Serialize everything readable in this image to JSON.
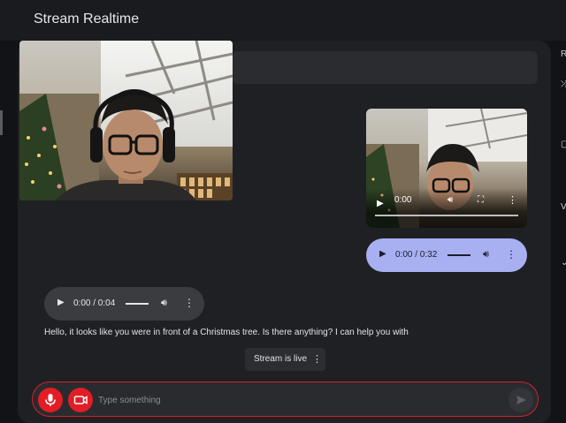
{
  "app": {
    "title": "Stream Realtime"
  },
  "right_rail": {
    "items": [
      "R",
      "⤮",
      "▢",
      "V",
      "⌄"
    ]
  },
  "video_message": {
    "time": "0:00",
    "play_icon": "play-icon",
    "volume_icon": "volume-icon",
    "fullscreen_icon": "fullscreen-icon",
    "more_icon": "more-vert-icon"
  },
  "audio_user": {
    "time": "0:00 / 0:32",
    "progress": 0
  },
  "audio_ai": {
    "time": "0:00 / 0:04",
    "progress": 0
  },
  "ai_message": {
    "text": "Hello, it looks like you were in front of a Christmas tree. Is there anything? I can help you with"
  },
  "stream_chip": {
    "label": "Stream is live"
  },
  "input": {
    "placeholder": "Type something"
  },
  "colors": {
    "accent_red": "#e31d25",
    "user_bubble": "#a8b0f2",
    "panel": "#1f2023",
    "background": "#121316"
  }
}
